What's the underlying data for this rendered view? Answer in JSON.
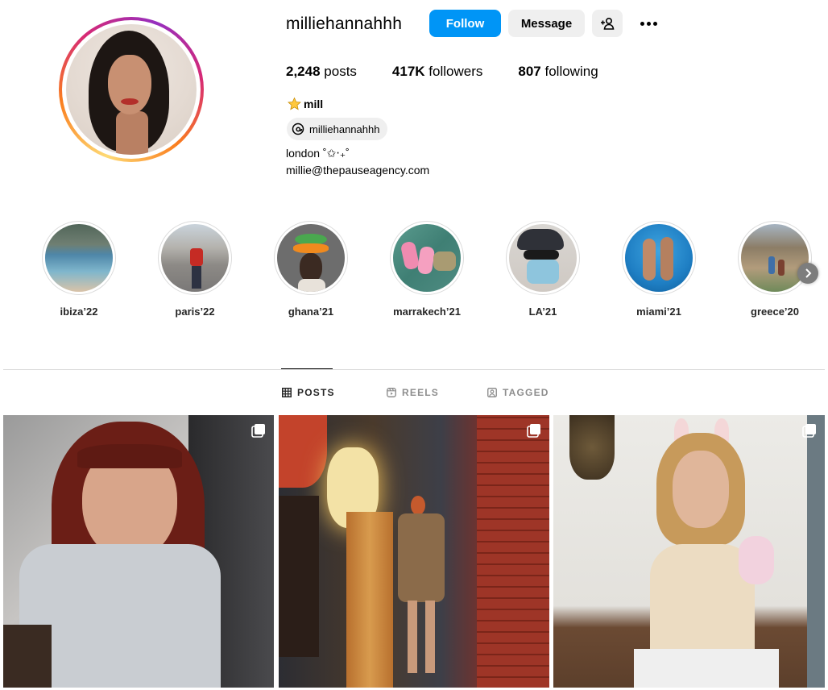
{
  "profile": {
    "username": "milliehannahhh",
    "follow_label": "Follow",
    "message_label": "Message",
    "stats": {
      "posts_count": "2,248",
      "posts_label": "posts",
      "followers_count": "417K",
      "followers_label": "followers",
      "following_count": "807",
      "following_label": "following"
    },
    "display_name": "mill",
    "threads_handle": "milliehannahhh",
    "bio_line_1": "london ⁠˚✩‧₊˚",
    "bio_line_2": "millie@thepauseagency.com"
  },
  "highlights": [
    {
      "label": "ibiza’22",
      "icon": "beach-photo"
    },
    {
      "label": "paris’22",
      "icon": "street-photo"
    },
    {
      "label": "ghana’21",
      "icon": "art-photo"
    },
    {
      "label": "marrakech’21",
      "icon": "slides-photo"
    },
    {
      "label": "LA’21",
      "icon": "selfie-photo"
    },
    {
      "label": "miami’21",
      "icon": "pool-photo"
    },
    {
      "label": "greece’20",
      "icon": "village-photo"
    }
  ],
  "tabs": [
    {
      "label": "POSTS",
      "icon": "grid-icon",
      "active": true
    },
    {
      "label": "REELS",
      "icon": "reels-icon",
      "active": false
    },
    {
      "label": "TAGGED",
      "icon": "tagged-icon",
      "active": false
    }
  ],
  "colors": {
    "primary_button": "#0095f6",
    "secondary_button": "#efefef",
    "muted_text": "#8e8e8e",
    "divider": "#dbdbdb"
  }
}
